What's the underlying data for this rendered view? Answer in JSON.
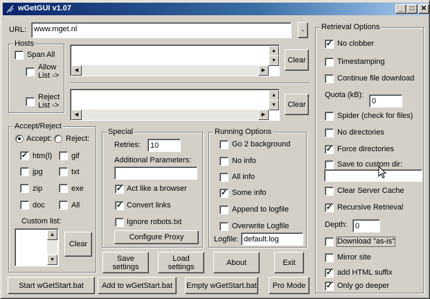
{
  "window": {
    "title": "wGetGUI v1.07",
    "icon": "feather-icon",
    "controls": {
      "minimize": "_",
      "maximize": "□",
      "close": "✕"
    }
  },
  "url": {
    "label": "URL:",
    "value": "www.mget.nl",
    "side_button": "-"
  },
  "hosts": {
    "legend": "Hosts",
    "span_all": {
      "label": "Span All",
      "checked": false
    },
    "allow_list": {
      "label_line1": "Allow",
      "label_line2": "List ->",
      "checked": false
    },
    "reject_list": {
      "label_line1": "Reject",
      "label_line2": "List ->",
      "checked": false
    },
    "clear_label": "Clear",
    "clear2_label": "Clear"
  },
  "accept_reject": {
    "legend": "Accept/Reject",
    "accept_label": "Accept:",
    "reject_label": "Reject:",
    "mode": "accept",
    "types": [
      {
        "label": "htm(l)",
        "checked": true
      },
      {
        "label": "gif",
        "checked": false
      },
      {
        "label": "jpg",
        "checked": false
      },
      {
        "label": "txt",
        "checked": false
      },
      {
        "label": "zip",
        "checked": false
      },
      {
        "label": "exe",
        "checked": false
      },
      {
        "label": "doc",
        "checked": false
      },
      {
        "label": "All",
        "checked": false
      }
    ],
    "custom_list_label": "Custom list:",
    "clear_label": "Clear"
  },
  "special": {
    "legend": "Special",
    "retries_label": "Retries:",
    "retries_value": "10",
    "additional_params_label": "Additional Parameters:",
    "additional_params_value": "",
    "act_like_browser": {
      "label": "Act like a browser",
      "checked": true
    },
    "convert_links": {
      "label": "Convert links",
      "checked": true
    },
    "ignore_robots": {
      "label": "Ignore robots.txt",
      "checked": false
    },
    "configure_proxy_label": "Configure Proxy"
  },
  "running": {
    "legend": "Running Options",
    "options": [
      {
        "label": "Go 2 background",
        "checked": false
      },
      {
        "label": "No info",
        "checked": false
      },
      {
        "label": "All info",
        "checked": false
      },
      {
        "label": "Some info",
        "checked": true
      },
      {
        "label": "Append to logfile",
        "checked": false
      },
      {
        "label": "Overwrite Logfile",
        "checked": false
      }
    ],
    "logfile_label": "Logfile:",
    "logfile_value": "default.log"
  },
  "buttons": {
    "save_line1": "Save",
    "save_line2": "settings",
    "load_line1": "Load",
    "load_line2": "settings",
    "about": "About",
    "exit": "Exit",
    "start": "Start wGetStart.bat",
    "add": "Add to wGetStart.bat",
    "empty": "Empty wGetStart.bat",
    "pro": "Pro Mode"
  },
  "retrieval": {
    "legend": "Retrieval Options",
    "no_clobber": {
      "label": "No clobber",
      "checked": true
    },
    "timestamping": {
      "label": "Timestamping",
      "checked": false
    },
    "continue_download": {
      "label": "Continue file download",
      "checked": false
    },
    "quota_label": "Quota (kB):",
    "quota_value": "0",
    "spider": {
      "label": "Spider (check for files)",
      "checked": false
    },
    "no_directories": {
      "label": "No directories",
      "checked": false
    },
    "force_directories": {
      "label": "Force directories",
      "checked": true
    },
    "save_custom_dir": {
      "label": "Save to custom dir:",
      "checked": false
    },
    "custom_dir_value": "",
    "clear_server_cache": {
      "label": "Clear Server Cache",
      "checked": false
    },
    "recursive": {
      "label": "Recursive Retrieval",
      "checked": true
    },
    "depth_label": "Depth:",
    "depth_value": "0",
    "download_as_is": {
      "label": "Download \"as-is\"",
      "checked": false
    },
    "mirror_site": {
      "label": "Mirror site",
      "checked": false
    },
    "html_suffix": {
      "label": "add HTML suffix",
      "checked": true
    },
    "only_deeper": {
      "label": "Only go deeper",
      "checked": true
    }
  }
}
